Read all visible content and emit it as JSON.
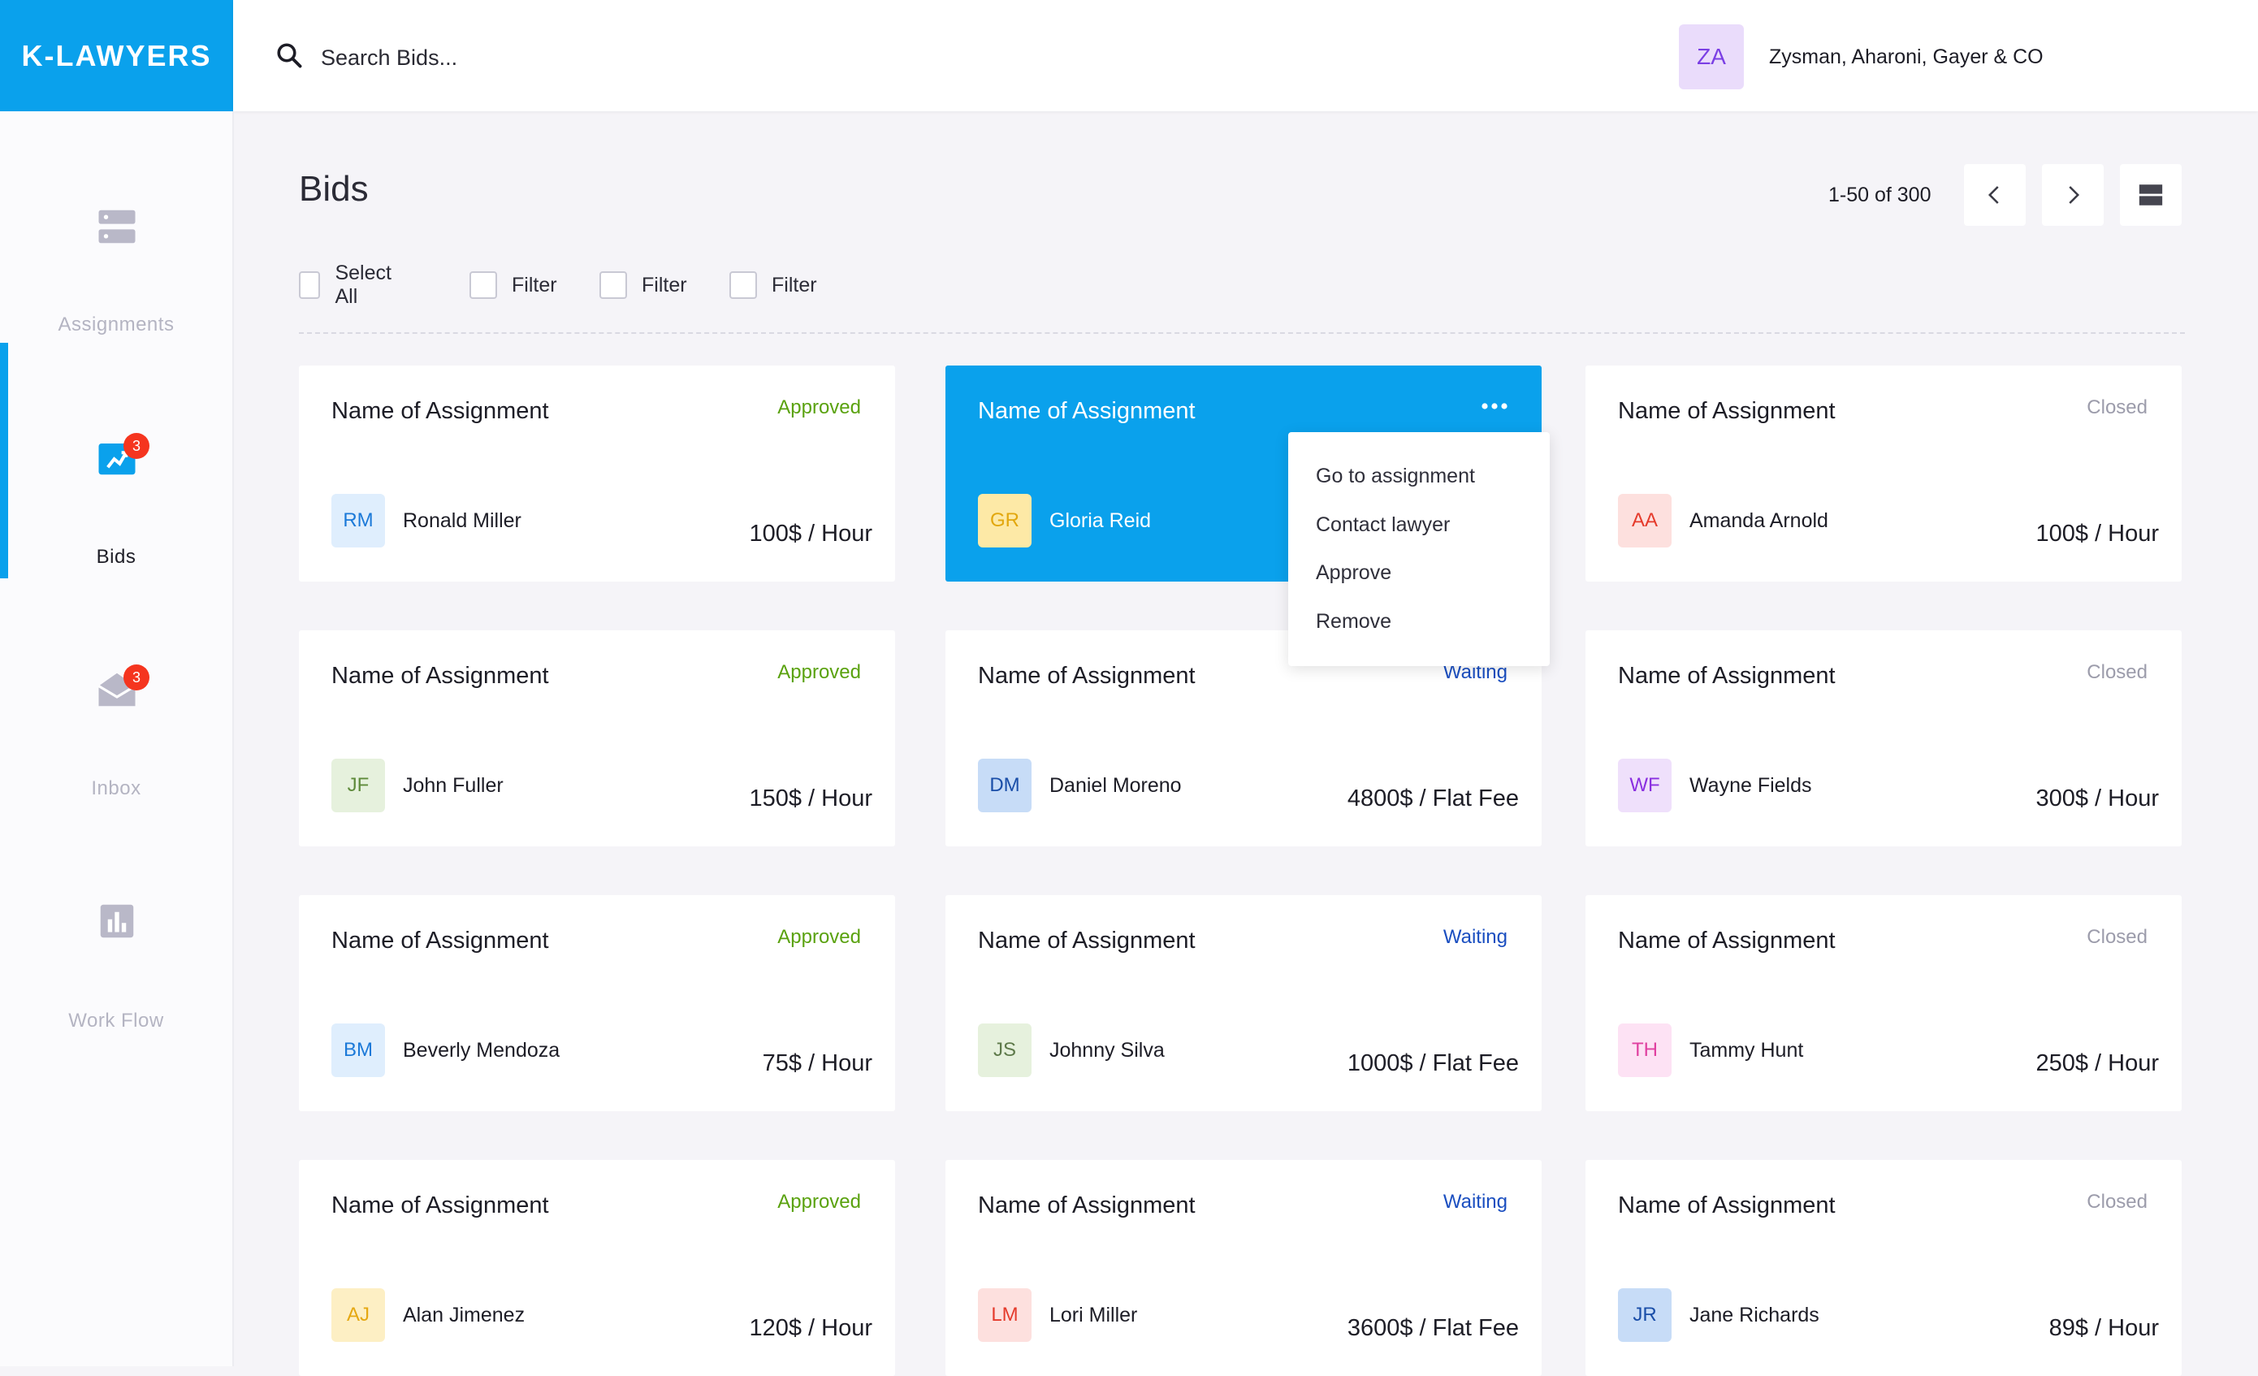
{
  "app": {
    "logo": "K-LAWYERS"
  },
  "search": {
    "placeholder": "Search Bids..."
  },
  "account": {
    "initials": "ZA",
    "name": "Zysman, Aharoni, Gayer & CO"
  },
  "sidebar": {
    "items": [
      {
        "label": "Assignments",
        "icon": "server-icon",
        "badge": null
      },
      {
        "label": "Bids",
        "icon": "bids-icon",
        "badge": "3"
      },
      {
        "label": "Inbox",
        "icon": "mail-icon",
        "badge": "3"
      },
      {
        "label": "Work Flow",
        "icon": "chart-icon",
        "badge": null
      }
    ]
  },
  "page": {
    "title": "Bids",
    "pagination": "1-50 of 300"
  },
  "filters": [
    "Select All",
    "Filter",
    "Filter",
    "Filter"
  ],
  "colors": {
    "accent": "#0aa1ec",
    "approved": "#5aa20f",
    "waiting": "#1a4ec0",
    "closed": "#9c9cab",
    "badge": "#f5351f"
  },
  "context_menu": [
    "Go to assignment",
    "Contact lawyer",
    "Approve",
    "Remove"
  ],
  "cards": [
    {
      "title": "Name of Assignment",
      "status": "Approved",
      "initials": "RM",
      "lawyer": "Ronald Miller",
      "price": "100$ / Hour"
    },
    {
      "title": "Name of Assignment",
      "status": "",
      "initials": "GR",
      "lawyer": "Gloria Reid",
      "price": ""
    },
    {
      "title": "Name of Assignment",
      "status": "Closed",
      "initials": "AA",
      "lawyer": "Amanda Arnold",
      "price": "100$ / Hour"
    },
    {
      "title": "Name of Assignment",
      "status": "Approved",
      "initials": "JF",
      "lawyer": "John Fuller",
      "price": "150$ / Hour"
    },
    {
      "title": "Name of Assignment",
      "status": "Waiting",
      "initials": "DM",
      "lawyer": "Daniel Moreno",
      "price": "4800$ / Flat Fee"
    },
    {
      "title": "Name of Assignment",
      "status": "Closed",
      "initials": "WF",
      "lawyer": "Wayne Fields",
      "price": "300$ / Hour"
    },
    {
      "title": "Name of Assignment",
      "status": "Approved",
      "initials": "BM",
      "lawyer": "Beverly Mendoza",
      "price": "75$ / Hour"
    },
    {
      "title": "Name of Assignment",
      "status": "Waiting",
      "initials": "JS",
      "lawyer": "Johnny Silva",
      "price": "1000$ / Flat Fee"
    },
    {
      "title": "Name of Assignment",
      "status": "Closed",
      "initials": "TH",
      "lawyer": "Tammy Hunt",
      "price": "250$ / Hour"
    },
    {
      "title": "Name of Assignment",
      "status": "Approved",
      "initials": "AJ",
      "lawyer": "Alan Jimenez",
      "price": "120$ / Hour"
    },
    {
      "title": "Name of Assignment",
      "status": "Waiting",
      "initials": "LM",
      "lawyer": "Lori Miller",
      "price": "3600$ / Flat Fee"
    },
    {
      "title": "Name of Assignment",
      "status": "Closed",
      "initials": "JR",
      "lawyer": "Jane Richards",
      "price": "89$ / Hour"
    }
  ]
}
